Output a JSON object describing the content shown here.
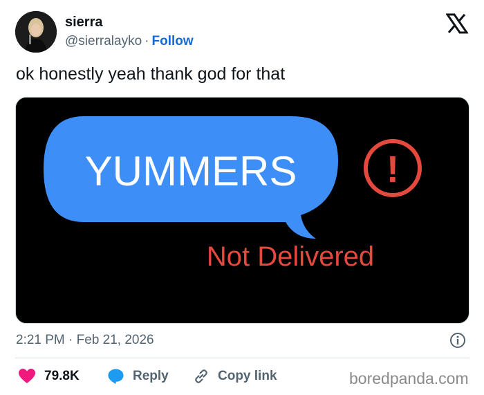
{
  "author": {
    "name": "sierra",
    "handle": "@sierralayko",
    "separator": "·",
    "follow_label": "Follow",
    "avatar_icon": "profile-photo-icon"
  },
  "platform_icon": "x-logo-icon",
  "tweet": {
    "text": "ok honestly yeah thank god for that",
    "timestamp": "2:21 PM · Feb 21, 2026"
  },
  "media": {
    "bubble_text": "YUMMERS",
    "status_text": "Not Delivered",
    "bubble_color": "#3d8ef7",
    "alert_color": "#e5483d",
    "alert_glyph": "!"
  },
  "actions": {
    "likes": "79.8K",
    "reply_label": "Reply",
    "copy_link_label": "Copy link",
    "like_color": "#f0197d",
    "reply_color": "#1d9bf0"
  },
  "watermark": "boredpanda.com"
}
